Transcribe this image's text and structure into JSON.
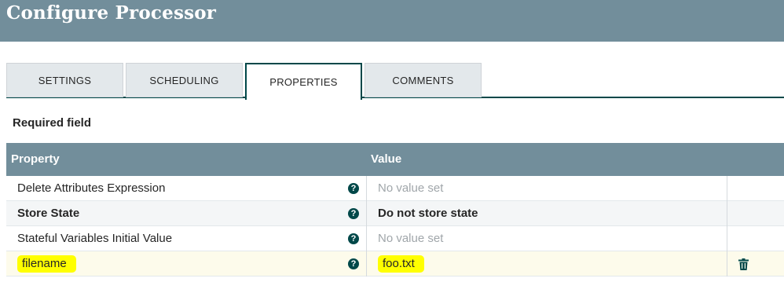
{
  "header": {
    "title": "Configure Processor"
  },
  "tabs": [
    {
      "label": "SETTINGS",
      "active": false
    },
    {
      "label": "SCHEDULING",
      "active": false
    },
    {
      "label": "PROPERTIES",
      "active": true
    },
    {
      "label": "COMMENTS",
      "active": false
    }
  ],
  "required_label": "Required field",
  "table": {
    "columns": {
      "property": "Property",
      "value": "Value"
    },
    "rows": [
      {
        "property": "Delete Attributes Expression",
        "value": "No value set",
        "help_icon": "question-circle-icon"
      },
      {
        "property": "Store State",
        "value": "Do not store state",
        "help_icon": "question-circle-icon"
      },
      {
        "property": "Stateful Variables Initial Value",
        "value": "No value set",
        "help_icon": "question-circle-icon"
      },
      {
        "property": "filename",
        "value": "foo.txt",
        "help_icon": "question-circle-icon",
        "delete_icon": "trash-icon"
      }
    ]
  },
  "colors": {
    "header_bg": "#728e9b",
    "tab_accent": "#004849",
    "highlight": "#ffff00"
  }
}
